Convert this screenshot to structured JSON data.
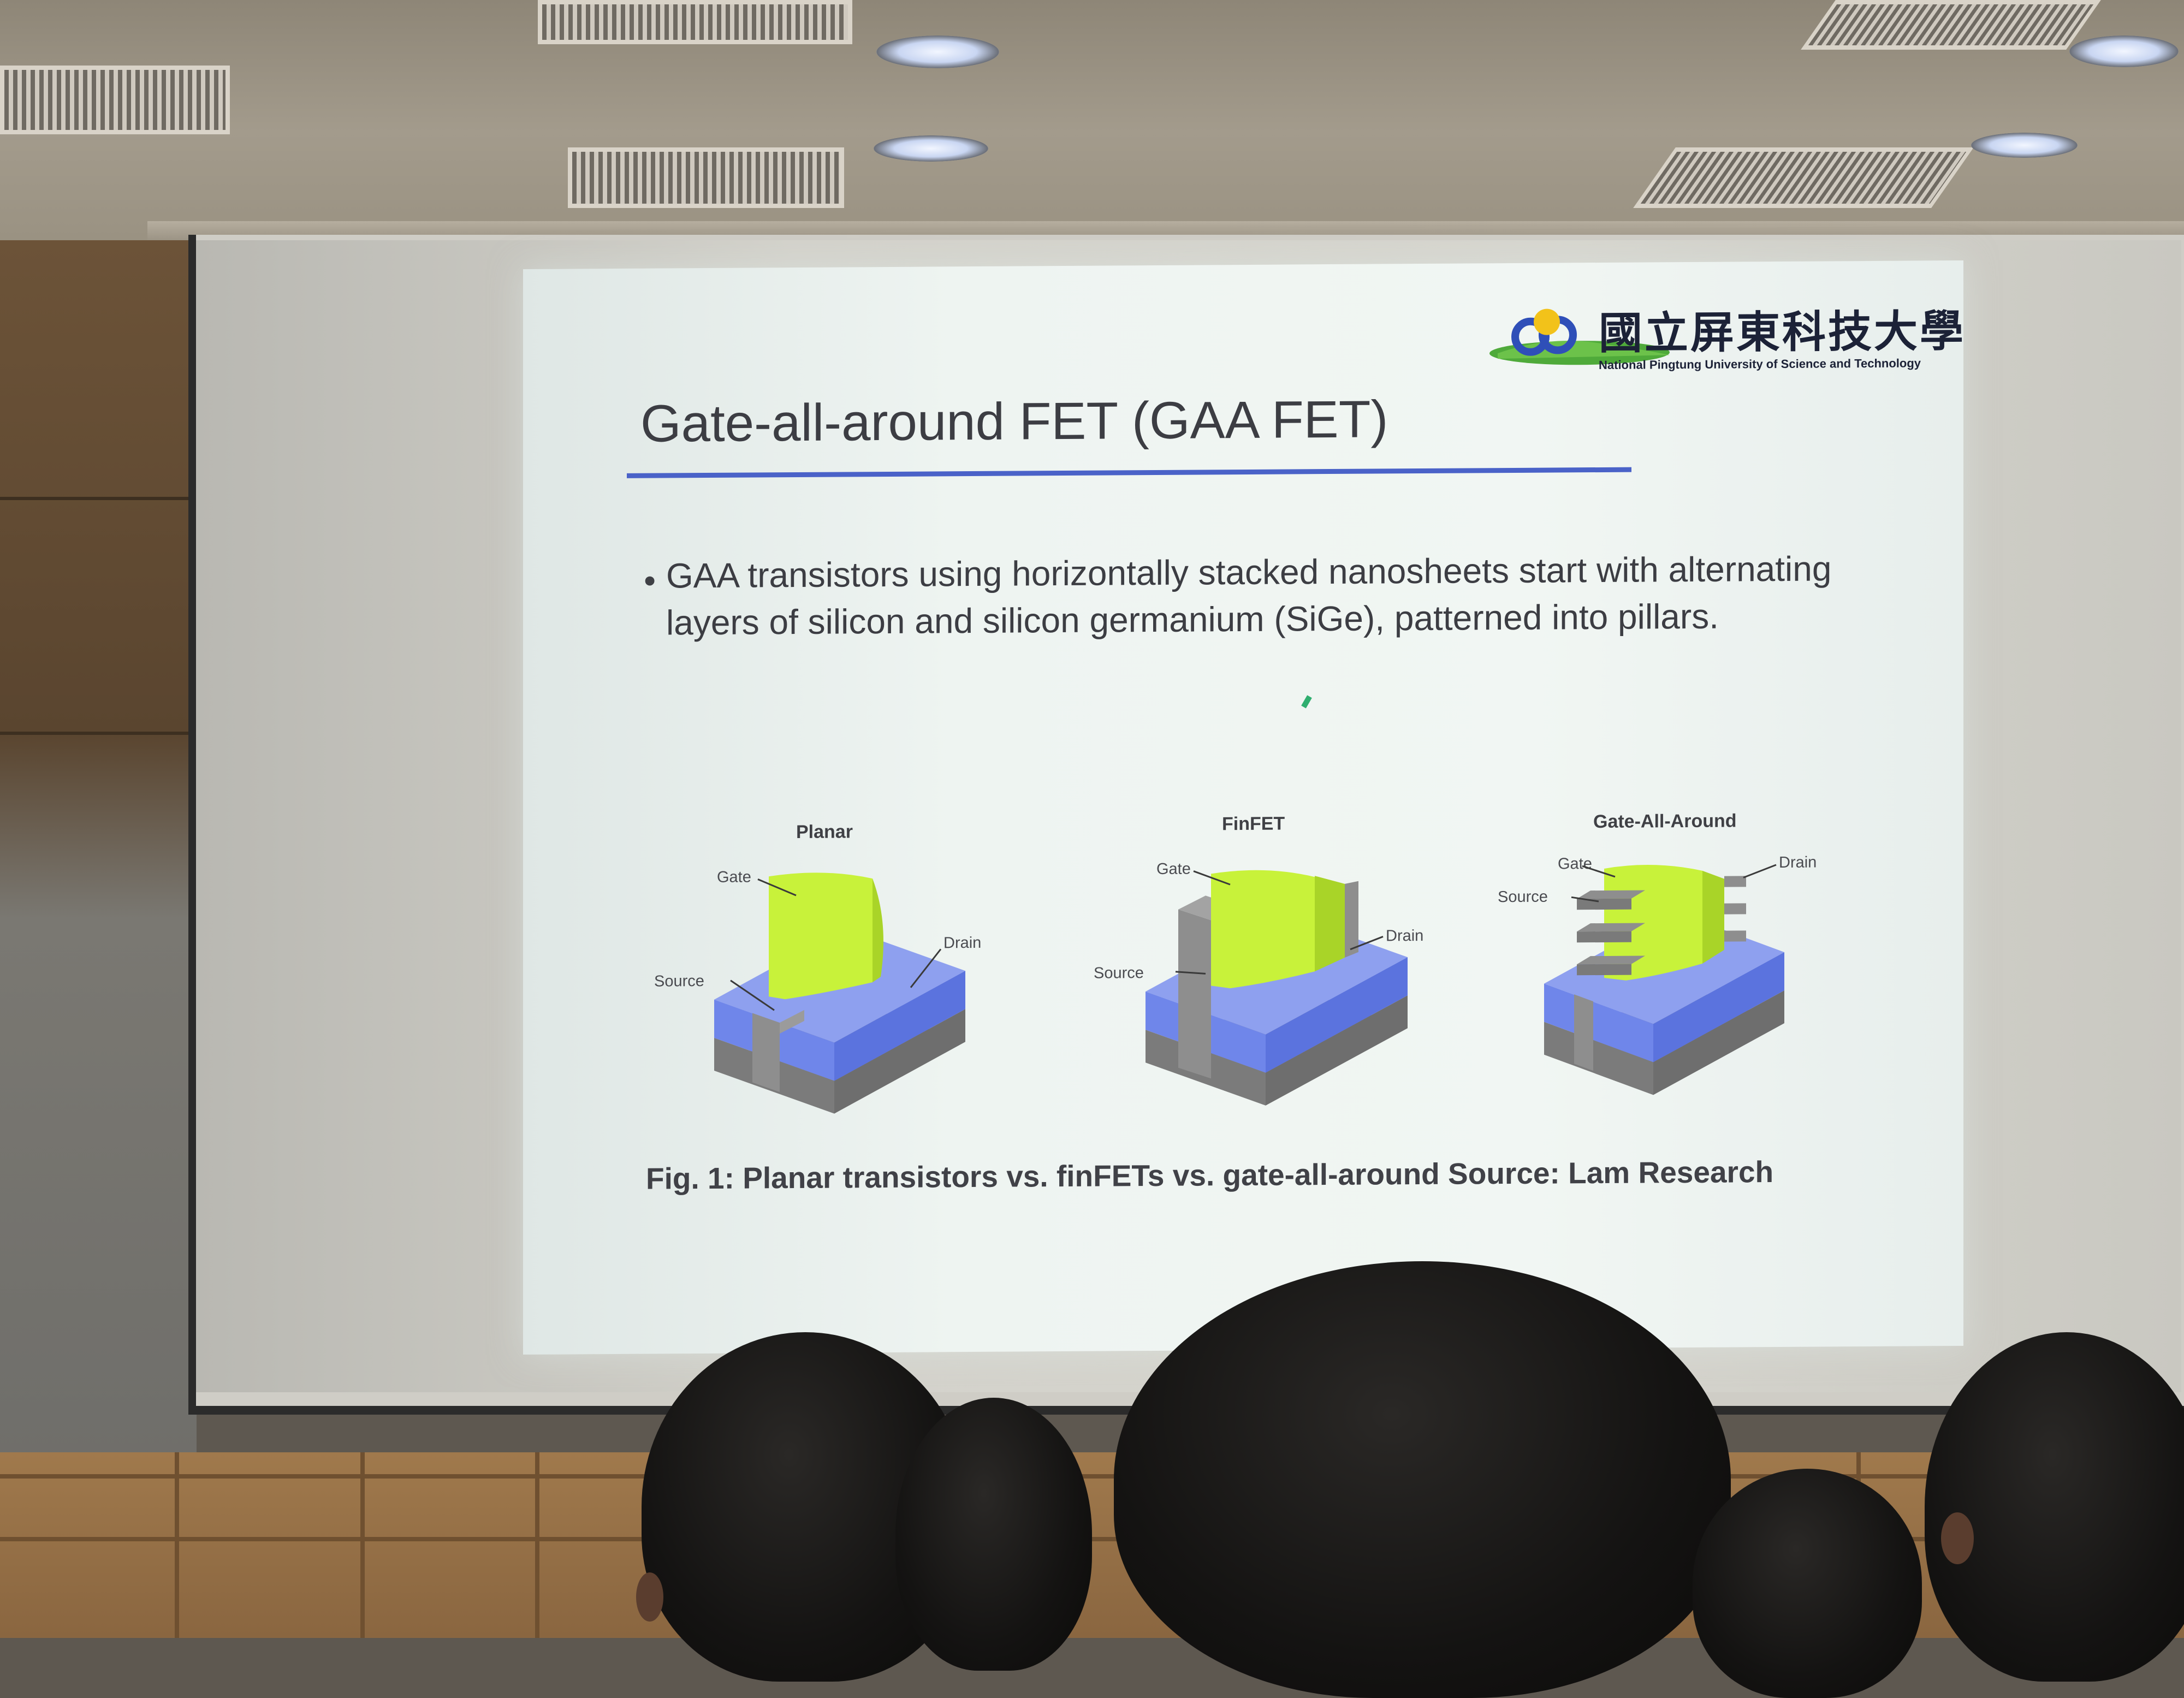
{
  "slide": {
    "logo_text_zh": "國立屏東科技大學",
    "logo_text_en": "National Pingtung University of Science and Technology",
    "title": "Gate-all-around FET (GAA FET)",
    "bullet": "GAA transistors using horizontally stacked nanosheets start with alternating layers of silicon and silicon germanium (SiGe), patterned into pillars.",
    "figure": {
      "panels": [
        {
          "title": "Planar",
          "gate": "Gate",
          "source": "Source",
          "drain": "Drain"
        },
        {
          "title": "FinFET",
          "gate": "Gate",
          "source": "Source",
          "drain": "Drain"
        },
        {
          "title": "Gate-All-Around",
          "gate": "Gate",
          "source": "Source",
          "drain": "Drain"
        }
      ]
    },
    "caption": "Fig. 1: Planar transistors vs. finFETs vs. gate-all-around Source: Lam Research"
  },
  "colors": {
    "gate": "#c8f23a",
    "substrate": "#6f86ea",
    "source_drain": "#8e8e8e",
    "title_rule": "#4a62c8"
  }
}
